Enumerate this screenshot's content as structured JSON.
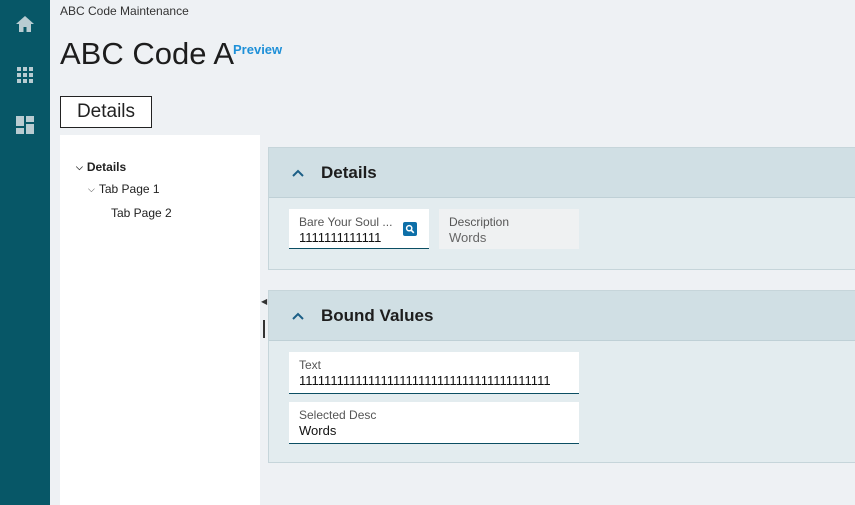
{
  "nav": {
    "icons": [
      "home-icon",
      "apps-grid-icon",
      "dashboard-icon"
    ],
    "color": "#075767"
  },
  "breadcrumb": "ABC Code Maintenance",
  "page": {
    "title": "ABC Code A",
    "preview_label": "Preview",
    "tab_label": "Details"
  },
  "tree": {
    "items": [
      {
        "label": "Details",
        "expanded": true
      },
      {
        "label": "Tab Page 1",
        "expanded": true
      },
      {
        "label": "Tab Page 2",
        "expanded": false
      }
    ]
  },
  "details_section": {
    "title": "Details",
    "fields": [
      {
        "label": "Bare Your Soul ...",
        "value": "1111111111111",
        "icon": "lookup-icon"
      },
      {
        "label": "Description",
        "value": "Words"
      }
    ]
  },
  "bound_section": {
    "title": "Bound Values",
    "fields": [
      {
        "label": "Text",
        "value": "1111111111111111111111111111111111111111"
      },
      {
        "label": "Selected Desc",
        "value": "Words"
      }
    ]
  },
  "colors": {
    "accent": "#1e90d8",
    "section_header": "#d0dfe4",
    "field_underline": "#0b4e63"
  }
}
